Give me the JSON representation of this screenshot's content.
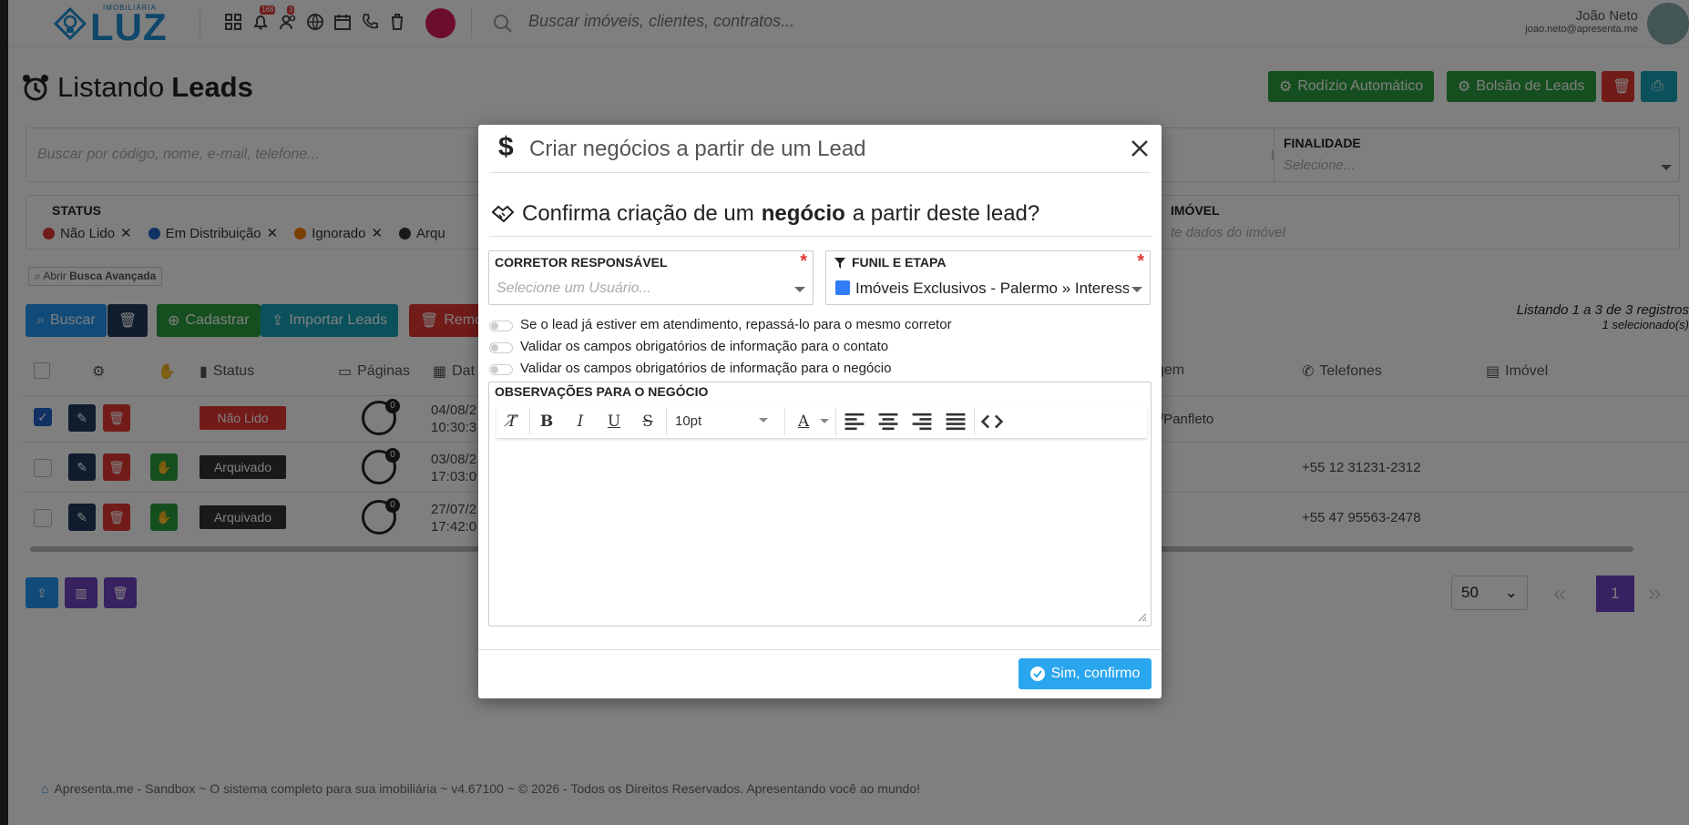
{
  "brand": {
    "subtitle": "IMOBILIÁRIA",
    "word": "LUZ"
  },
  "topbar": {
    "badges": {
      "notifications": "168",
      "people": "3"
    },
    "search_placeholder": "Buscar imóveis, clientes, contratos...",
    "user_name": "João Neto",
    "user_email": "joao.neto@apresenta.me"
  },
  "page": {
    "title_prefix": "Listando",
    "title_bold": "Leads"
  },
  "actions": {
    "rodizio": "Rodízio Automático",
    "bolsao": "Bolsão de Leads"
  },
  "filters": {
    "search_placeholder": "Buscar por código, nome, e-mail, telefone...",
    "finalidade_label": "FINALIDADE",
    "finalidade_placeholder": "Selecione...",
    "status_label": "STATUS",
    "status_chips": [
      {
        "label": "Não Lido",
        "color": "#e53935"
      },
      {
        "label": "Em Distribuição",
        "color": "#1e63c9"
      },
      {
        "label": "Ignorado",
        "color": "#f57c00"
      },
      {
        "label": "Arqu",
        "color": "#333333"
      }
    ],
    "imovel_label": "IMÓVEL",
    "imovel_placeholder": "te dados do imóvel",
    "advanced_prefix": "Abrir",
    "advanced_bold": "Busca Avançada"
  },
  "toolbar": {
    "buscar": "Buscar",
    "cadastrar": "Cadastrar",
    "importar": "Importar Leads",
    "remover": "Remo"
  },
  "listing": {
    "summary": "Listando 1 a 3 de 3 registros",
    "selected": "1 selecionado(s)"
  },
  "table": {
    "headers": {
      "status": "Status",
      "paginas": "Páginas",
      "data": "Dat",
      "origem": "gem",
      "telefones": "Telefones",
      "imovel": "Imóvel"
    },
    "rows": [
      {
        "status": "Não Lido",
        "status_color": "#e53935",
        "count": "0",
        "date": "04/08/2",
        "time": "10:30:3",
        "origin": "/Panfleto",
        "phone": "",
        "checked": true
      },
      {
        "status": "Arquivado",
        "status_color": "#333333",
        "count": "0",
        "date": "03/08/2",
        "time": "17:03:0",
        "origin": "",
        "phone": "+55 12 31231-2312",
        "checked": false
      },
      {
        "status": "Arquivado",
        "status_color": "#333333",
        "count": "0",
        "date": "27/07/2",
        "time": "17:42:0",
        "origin": "",
        "phone": "+55 47 95563-2478",
        "checked": false
      }
    ]
  },
  "pagination": {
    "per_page": "50",
    "current": "1"
  },
  "footer": {
    "text": "Apresenta.me - Sandbox ~ O sistema completo para sua imobiliária ~ v4.67100 ~ © 2026 - Todos os Direitos Reservados. Apresentando você ao mundo!"
  },
  "modal": {
    "title": "Criar negócios a partir de um Lead",
    "question_pre": "Confirma criação de um",
    "question_bold": "negócio",
    "question_post": "a partir deste lead?",
    "corretor_label": "CORRETOR RESPONSÁVEL",
    "corretor_placeholder": "Selecione um Usuário...",
    "funil_label": "FUNIL E ETAPA",
    "funil_value": "Imóveis Exclusivos - Palermo » Interess",
    "funil_color": "#2f7cf6",
    "required_mark": "*",
    "toggles": [
      "Se o lead já estiver em atendimento, repassá-lo para o mesmo corretor",
      "Validar os campos obrigatórios de informação para o contato",
      "Validar os campos obrigatórios de informação para o negócio"
    ],
    "obs_label": "OBSERVAÇÕES PARA O NEGÓCIO",
    "font_size": "10pt",
    "confirm_label": "Sim, confirmo"
  }
}
